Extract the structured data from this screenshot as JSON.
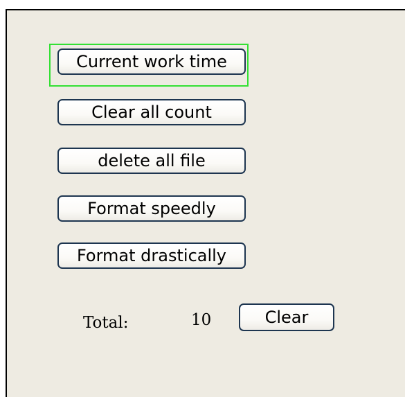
{
  "menu": {
    "items": [
      {
        "label": "Current work time",
        "selected": true
      },
      {
        "label": "Clear all count",
        "selected": false
      },
      {
        "label": "delete all file",
        "selected": false
      },
      {
        "label": "Format speedly",
        "selected": false
      },
      {
        "label": "Format drastically",
        "selected": false
      }
    ]
  },
  "total": {
    "label": "Total:",
    "value": "10",
    "clear_label": "Clear"
  },
  "colors": {
    "background": "#eeebe2",
    "button_border": "#1d3550",
    "focus_ring": "#33e033"
  }
}
